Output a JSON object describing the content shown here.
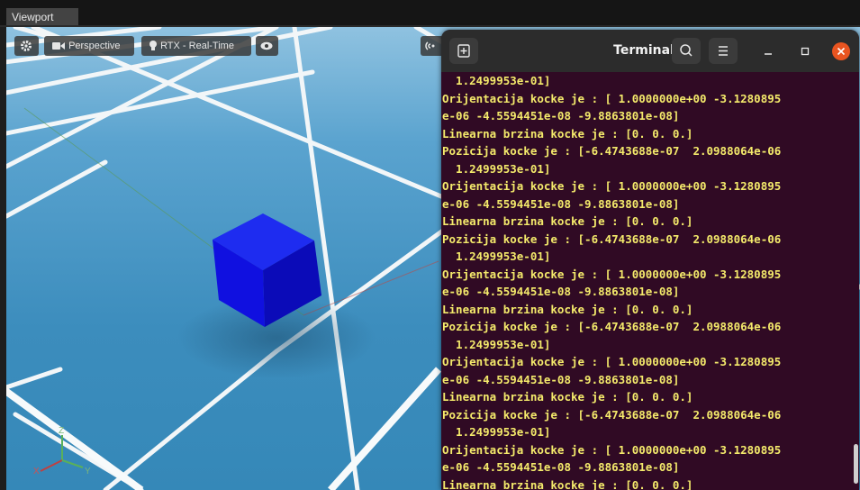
{
  "viewport": {
    "tab_label": "Viewport",
    "camera_label": "Perspective",
    "render_label": "RTX - Real-Time",
    "axis_labels": {
      "z": "Z",
      "x": "X",
      "y": "Y"
    },
    "icons": [
      "gear-icon",
      "camera-icon",
      "lightbulb-icon",
      "eye-icon",
      "signal-icon"
    ]
  },
  "terminal": {
    "title": "Terminal",
    "lines": [
      "  1.2499953e-01]",
      "Orijentacija kocke je : [ 1.0000000e+00 -3.1280895",
      "e-06 -4.5594451e-08 -9.8863801e-08]",
      "Linearna brzina kocke je : [0. 0. 0.]",
      "Pozicija kocke je : [-6.4743688e-07  2.0988064e-06",
      "  1.2499953e-01]",
      "Orijentacija kocke je : [ 1.0000000e+00 -3.1280895",
      "e-06 -4.5594451e-08 -9.8863801e-08]",
      "Linearna brzina kocke je : [0. 0. 0.]",
      "Pozicija kocke je : [-6.4743688e-07  2.0988064e-06",
      "  1.2499953e-01]",
      "Orijentacija kocke je : [ 1.0000000e+00 -3.1280895",
      "e-06 -4.5594451e-08 -9.8863801e-08]",
      "Linearna brzina kocke je : [0. 0. 0.]",
      "Pozicija kocke je : [-6.4743688e-07  2.0988064e-06",
      "  1.2499953e-01]",
      "Orijentacija kocke je : [ 1.0000000e+00 -3.1280895",
      "e-06 -4.5594451e-08 -9.8863801e-08]",
      "Linearna brzina kocke je : [0. 0. 0.]",
      "Pozicija kocke je : [-6.4743688e-07  2.0988064e-06",
      "  1.2499953e-01]",
      "Orijentacija kocke je : [ 1.0000000e+00 -3.1280895",
      "e-06 -4.5594451e-08 -9.8863801e-08]",
      "Linearna brzina kocke je : [0. 0. 0.]"
    ],
    "icons": [
      "new-tab-icon",
      "search-icon",
      "menu-icon",
      "minimize-icon",
      "maximize-icon",
      "close-icon"
    ]
  },
  "colors": {
    "terminal_bg": "#300a24",
    "terminal_text": "#f4ea6b",
    "cube": "#1010e0",
    "floor": "#3d8fbf",
    "close_button": "#e95420"
  }
}
